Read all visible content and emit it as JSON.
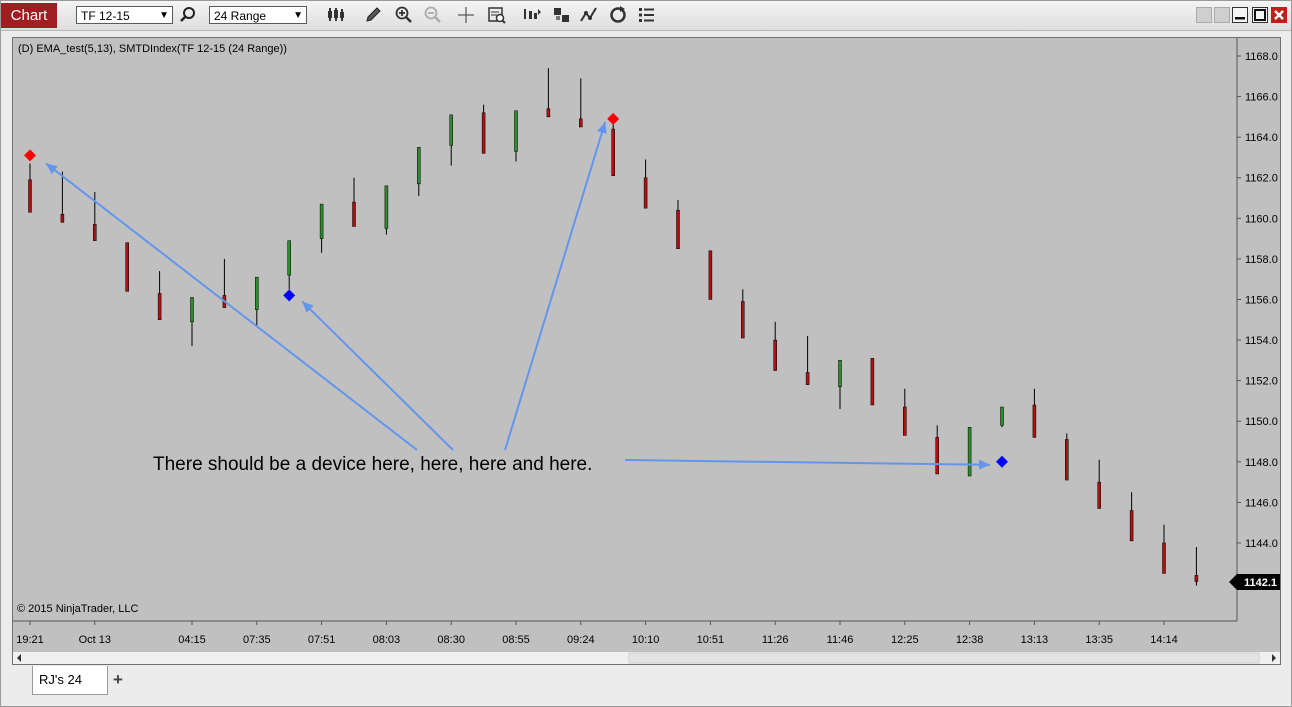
{
  "toolbar": {
    "chart_tab_label": "Chart",
    "instrument": "TF 12-15",
    "interval": "24 Range",
    "icons": [
      "search-icon",
      "bar-type-icon",
      "pencil-icon",
      "zoom-in-icon",
      "zoom-out-icon",
      "crosshair-icon",
      "data-box-icon",
      "plot-executions-icon",
      "strategies-icon",
      "indicators-icon",
      "reload-icon",
      "properties-icon"
    ],
    "window_buttons": [
      "tile-icon",
      "restore-small-icon",
      "minimize-icon",
      "maximize-icon",
      "close-icon"
    ]
  },
  "chart": {
    "header_label": "(D) EMA_test(5,13), SMTDIndex(TF 12-15 (24 Range))",
    "copyright": "© 2015 NinjaTrader, LLC",
    "annotation": "There should be a device here, here, here and here.",
    "last_price_label": "1142.1",
    "price_ticks": [
      "1168.0",
      "1166.0",
      "1164.0",
      "1162.0",
      "1160.0",
      "1158.0",
      "1156.0",
      "1154.0",
      "1152.0",
      "1150.0",
      "1148.0",
      "1146.0",
      "1144.0"
    ],
    "time_ticks": [
      "19:21",
      "Oct 13",
      "04:15",
      "07:35",
      "07:51",
      "08:03",
      "08:30",
      "08:55",
      "09:24",
      "10:10",
      "10:51",
      "11:26",
      "11:46",
      "12:25",
      "12:38",
      "13:13",
      "13:35",
      "14:14"
    ],
    "colors": {
      "background": "#c0c0c0",
      "up_bar": "#2e8b2e",
      "down_bar": "#b01010",
      "sell_marker": "#ff0000",
      "buy_marker": "#0000ff",
      "arrow": "#6495ed",
      "last_price_bg": "#000000"
    }
  },
  "chart_data": {
    "type": "candlestick",
    "ylim": [
      1141,
      1169
    ],
    "candles": [
      {
        "o": 1161.9,
        "h": 1162.7,
        "l": 1160.3,
        "c": 1160.3
      },
      {
        "o": 1160.2,
        "h": 1162.3,
        "l": 1159.8,
        "c": 1159.8
      },
      {
        "o": 1159.7,
        "h": 1161.3,
        "l": 1158.9,
        "c": 1158.9
      },
      {
        "o": 1158.8,
        "h": 1158.8,
        "l": 1156.4,
        "c": 1156.4
      },
      {
        "o": 1156.3,
        "h": 1157.4,
        "l": 1155.0,
        "c": 1155.0
      },
      {
        "o": 1154.9,
        "h": 1156.1,
        "l": 1153.7,
        "c": 1156.1
      },
      {
        "o": 1156.2,
        "h": 1158.0,
        "l": 1155.6,
        "c": 1155.6
      },
      {
        "o": 1155.5,
        "h": 1157.1,
        "l": 1154.7,
        "c": 1157.1
      },
      {
        "o": 1157.2,
        "h": 1158.9,
        "l": 1156.5,
        "c": 1158.9
      },
      {
        "o": 1159.0,
        "h": 1160.7,
        "l": 1158.3,
        "c": 1160.7
      },
      {
        "o": 1160.8,
        "h": 1162.0,
        "l": 1159.6,
        "c": 1159.6
      },
      {
        "o": 1159.5,
        "h": 1161.6,
        "l": 1159.2,
        "c": 1161.6
      },
      {
        "o": 1161.7,
        "h": 1163.5,
        "l": 1161.1,
        "c": 1163.5
      },
      {
        "o": 1163.6,
        "h": 1165.1,
        "l": 1162.6,
        "c": 1165.1
      },
      {
        "o": 1165.2,
        "h": 1165.6,
        "l": 1163.2,
        "c": 1163.2
      },
      {
        "o": 1163.3,
        "h": 1165.3,
        "l": 1162.8,
        "c": 1165.3
      },
      {
        "o": 1165.4,
        "h": 1167.4,
        "l": 1165.0,
        "c": 1165.0
      },
      {
        "o": 1164.9,
        "h": 1166.9,
        "l": 1164.5,
        "c": 1164.5
      },
      {
        "o": 1164.4,
        "h": 1164.7,
        "l": 1162.1,
        "c": 1162.1
      },
      {
        "o": 1162.0,
        "h": 1162.9,
        "l": 1160.5,
        "c": 1160.5
      },
      {
        "o": 1160.4,
        "h": 1160.9,
        "l": 1158.5,
        "c": 1158.5
      },
      {
        "o": 1158.4,
        "h": 1158.4,
        "l": 1156.0,
        "c": 1156.0
      },
      {
        "o": 1155.9,
        "h": 1156.5,
        "l": 1154.1,
        "c": 1154.1
      },
      {
        "o": 1154.0,
        "h": 1154.9,
        "l": 1152.5,
        "c": 1152.5
      },
      {
        "o": 1152.4,
        "h": 1154.2,
        "l": 1151.8,
        "c": 1151.8
      },
      {
        "o": 1151.7,
        "h": 1153.0,
        "l": 1150.6,
        "c": 1153.0
      },
      {
        "o": 1153.1,
        "h": 1153.1,
        "l": 1150.8,
        "c": 1150.8
      },
      {
        "o": 1150.7,
        "h": 1151.6,
        "l": 1149.3,
        "c": 1149.3
      },
      {
        "o": 1149.2,
        "h": 1149.8,
        "l": 1147.4,
        "c": 1147.4
      },
      {
        "o": 1147.3,
        "h": 1149.7,
        "l": 1147.3,
        "c": 1149.7
      },
      {
        "o": 1149.8,
        "h": 1150.7,
        "l": 1149.7,
        "c": 1150.7
      },
      {
        "o": 1150.8,
        "h": 1151.6,
        "l": 1149.2,
        "c": 1149.2
      },
      {
        "o": 1149.1,
        "h": 1149.4,
        "l": 1147.1,
        "c": 1147.1
      },
      {
        "o": 1147.0,
        "h": 1148.1,
        "l": 1145.7,
        "c": 1145.7
      },
      {
        "o": 1145.6,
        "h": 1146.5,
        "l": 1144.1,
        "c": 1144.1
      },
      {
        "o": 1144.0,
        "h": 1144.9,
        "l": 1142.5,
        "c": 1142.5
      },
      {
        "o": 1142.4,
        "h": 1143.8,
        "l": 1141.9,
        "c": 1142.1
      }
    ],
    "markers": [
      {
        "bar": 0,
        "price": 1163.1,
        "kind": "sell"
      },
      {
        "bar": 8,
        "price": 1156.2,
        "kind": "buy"
      },
      {
        "bar": 18,
        "price": 1164.9,
        "kind": "sell"
      },
      {
        "bar": 30,
        "price": 1148.0,
        "kind": "buy"
      }
    ]
  }
}
